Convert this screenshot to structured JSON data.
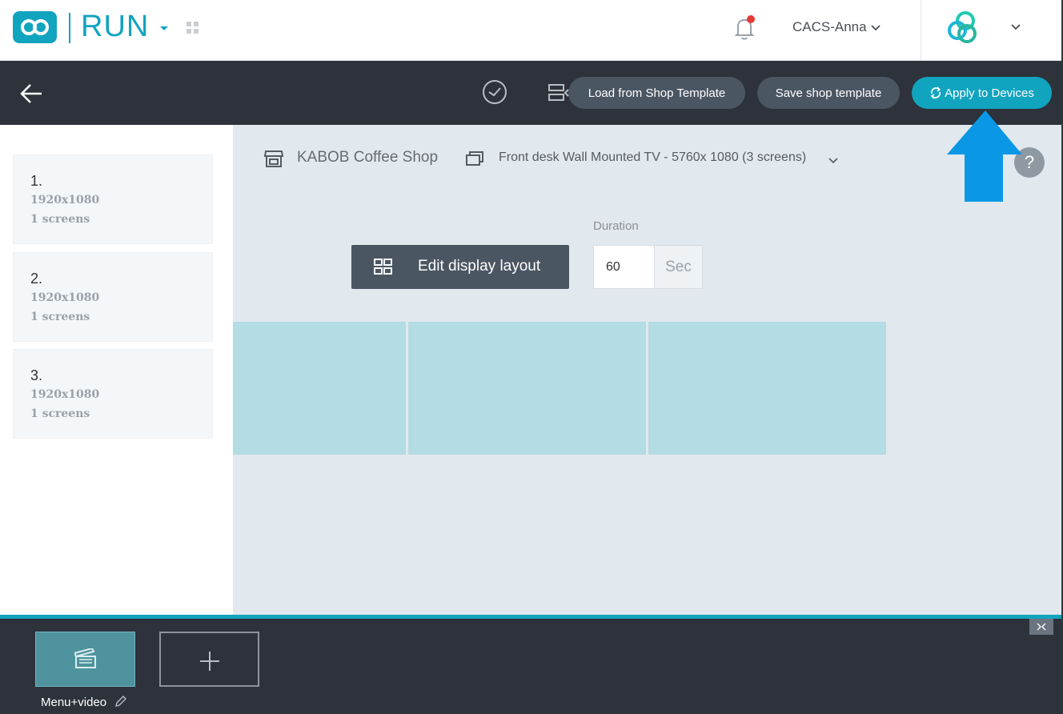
{
  "header": {
    "app_name": "RUN",
    "user_name": "CACS-Anna",
    "icons": [
      "logo-infinity-icon",
      "grid-icon",
      "bell-icon",
      "chevron-down-icon",
      "brand-rings-icon"
    ],
    "notification_dot_color": "#e53935"
  },
  "toolbar": {
    "load_label": "Load from Shop Template",
    "save_label": "Save shop template",
    "apply_label": "Apply to Devices"
  },
  "sidebar": {
    "items": [
      {
        "number": "1.",
        "resolution": "1920x1080",
        "screens": "1 screens"
      },
      {
        "number": "2.",
        "resolution": "1920x1080",
        "screens": "1 screens"
      },
      {
        "number": "3.",
        "resolution": "1920x1080",
        "screens": "1 screens"
      }
    ]
  },
  "main": {
    "shop_name": "KABOB Coffee Shop",
    "display_name": "Front desk Wall Mounted TV - 5760x 1080 (3 screens)",
    "help_label": "?",
    "edit_label": "Edit display layout",
    "duration_label": "Duration",
    "duration_value": "60",
    "duration_unit": "Sec"
  },
  "playlist": {
    "item_label": "Menu+video"
  },
  "colors": {
    "accent": "#11a4bf",
    "toolbar_bg": "#2d323b",
    "button_bg": "#4b5663",
    "screen_fill": "#b3dce4",
    "canvas_bg": "#e1e8ee",
    "arrow": "#0a98e6"
  }
}
